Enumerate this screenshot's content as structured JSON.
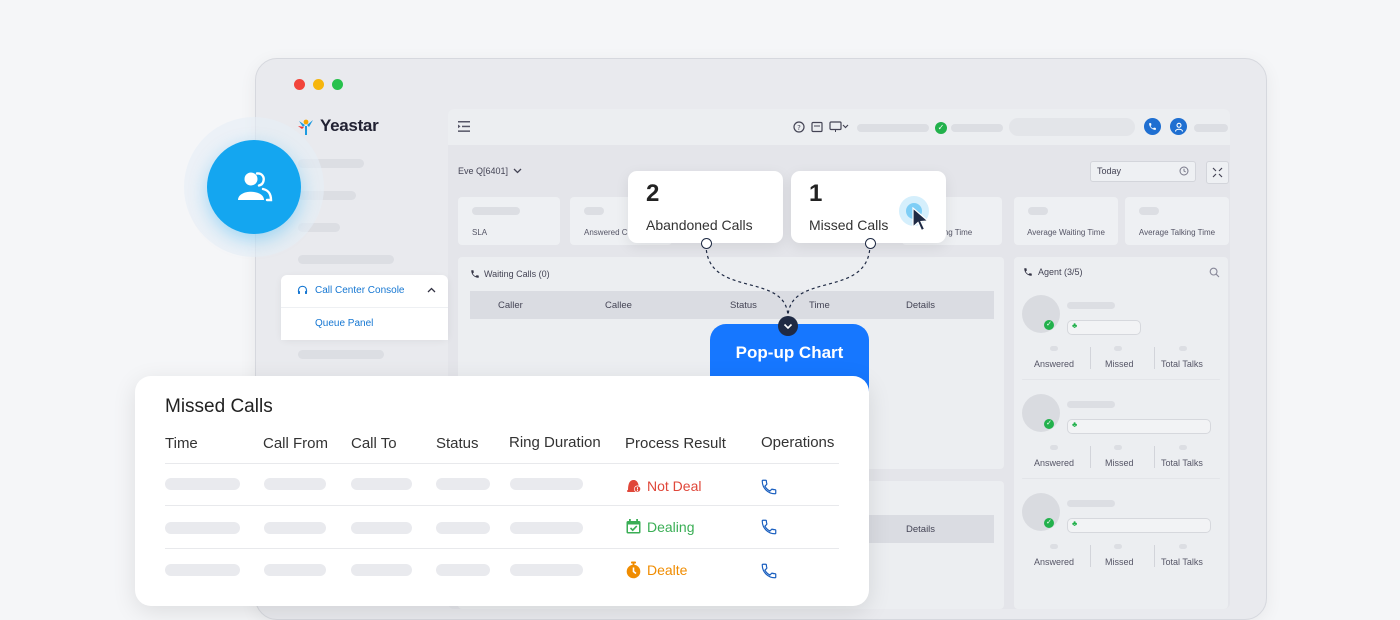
{
  "window": {
    "brand": "Yeastar"
  },
  "sidebar": {
    "menu_parent": "Call Center Console",
    "menu_child": "Queue Panel"
  },
  "queue": {
    "selector": "Eve Q[6401]"
  },
  "date_filter": {
    "value": "Today"
  },
  "stat_cards": {
    "sla": "SLA",
    "answered": "Answered C",
    "waiting_time_partial": "iting Time",
    "avg_waiting": "Average Waiting Time",
    "avg_talking": "Average Talking Time"
  },
  "waiting_calls": {
    "title": "Waiting Calls (0)",
    "columns": [
      "Caller",
      "Callee",
      "Status",
      "Time",
      "Details"
    ]
  },
  "lower_table": {
    "details": "Details"
  },
  "agents": {
    "title": "Agent (3/5)",
    "stat_labels": [
      "Answered",
      "Missed",
      "Total Talks"
    ]
  },
  "popups": {
    "abandoned": {
      "count": "2",
      "label": "Abandoned Calls"
    },
    "missed": {
      "count": "1",
      "label": "Missed Calls"
    },
    "popup_chart_label": "Pop-up Chart"
  },
  "missed_panel": {
    "title": "Missed Calls",
    "columns": [
      "Time",
      "Call From",
      "Call To",
      "Status",
      "Ring Duration",
      "Process Result",
      "Operations"
    ],
    "rows": [
      {
        "result": "Not Deal",
        "result_color": "#e0473a",
        "result_icon": "alarm-icon"
      },
      {
        "result": "Dealing",
        "result_color": "#3aae55",
        "result_icon": "calendar-check-icon"
      },
      {
        "result": "Dealte",
        "result_color": "#f08c00",
        "result_icon": "timer-icon"
      }
    ]
  },
  "colors": {
    "accent": "#1677ff",
    "brand_blue": "#14a6f0",
    "ok_green": "#22b14c"
  }
}
